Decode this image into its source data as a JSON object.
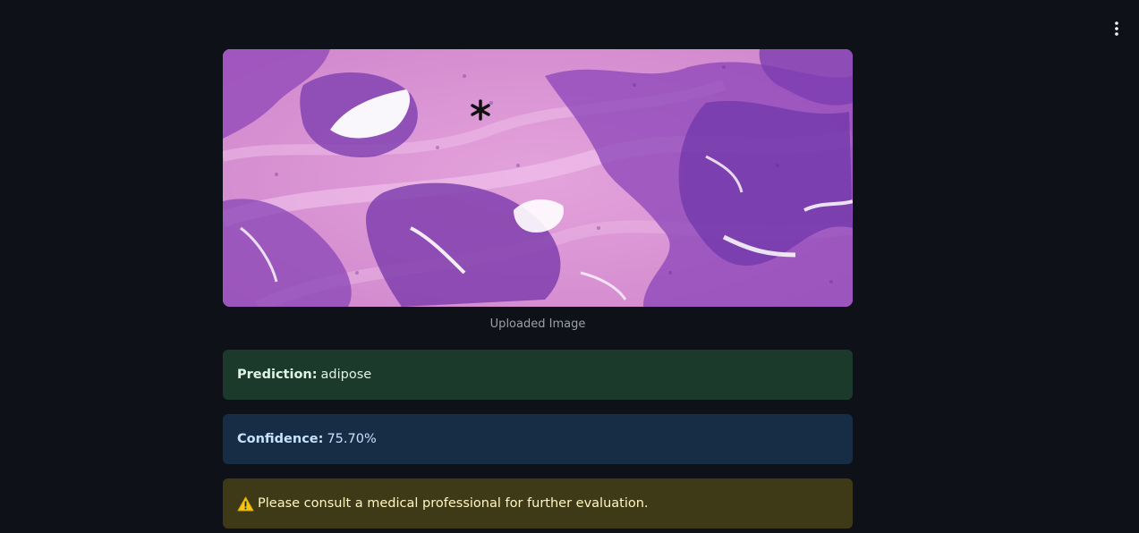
{
  "image": {
    "caption": "Uploaded Image"
  },
  "results": {
    "prediction_label": "Prediction:",
    "prediction_value": "adipose",
    "confidence_label": "Confidence:",
    "confidence_value": "75.70%",
    "warning_text": "Please consult a medical professional for further evaluation."
  },
  "icons": {
    "menu": "kebab-menu-icon",
    "warning": "warning-icon"
  },
  "colors": {
    "background": "#0e1117",
    "success_bg": "#1b3a2b",
    "info_bg": "#172d45",
    "warning_bg": "#3e3a18"
  }
}
